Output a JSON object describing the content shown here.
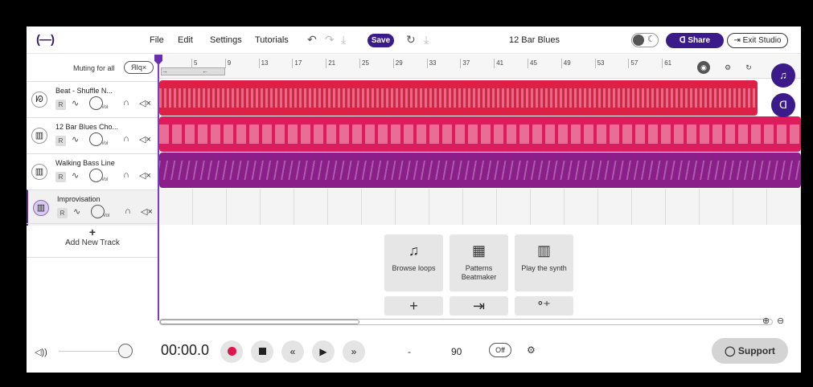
{
  "header": {
    "logo": "(—)",
    "menu": [
      "File",
      "Edit",
      "Settings",
      "Tutorials"
    ],
    "save_label": "Save",
    "project_title": "12 Bar Blues",
    "share_label": "Share",
    "exit_label": "Exit Studio"
  },
  "tracks_header": {
    "muting_label": "Muting for all",
    "mute_all_label": "ЯIq×"
  },
  "tracks": [
    {
      "name": "Beat - Shuffle N...",
      "icon": "drum-icon",
      "glyph": "ᘗ",
      "r": "R",
      "vol": "Vol"
    },
    {
      "name": "12 Bar Blues Cho...",
      "icon": "keyboard-icon",
      "glyph": "▥",
      "r": "R",
      "vol": "Vol"
    },
    {
      "name": "Walking Bass Line",
      "icon": "keyboard-icon",
      "glyph": "▥",
      "r": "R",
      "vol": "Vol"
    },
    {
      "name": "Improvisation",
      "icon": "keyboard-icon",
      "glyph": "▥",
      "r": "R",
      "vol": "Vol"
    }
  ],
  "add_track_label": "Add New Track",
  "ruler": {
    "bars": [
      "5",
      "9",
      "13",
      "17",
      "21",
      "25",
      "29",
      "33",
      "37",
      "41",
      "45",
      "49",
      "53",
      "57",
      "61"
    ]
  },
  "tiles": [
    {
      "icon": "♫",
      "label": "Browse loops"
    },
    {
      "icon": "▦",
      "label": "Patterns Beatmaker"
    },
    {
      "icon": "▥",
      "label": "Play the synth"
    }
  ],
  "transport": {
    "time": "00:00.0",
    "dash": "-",
    "bpm": "90",
    "metronome": "Off",
    "support_label": "Support"
  },
  "colors": {
    "accent": "#3b1a8a",
    "beat": "#dd2046",
    "chords": "#dc1c5c",
    "bass": "#8a1f8a"
  }
}
